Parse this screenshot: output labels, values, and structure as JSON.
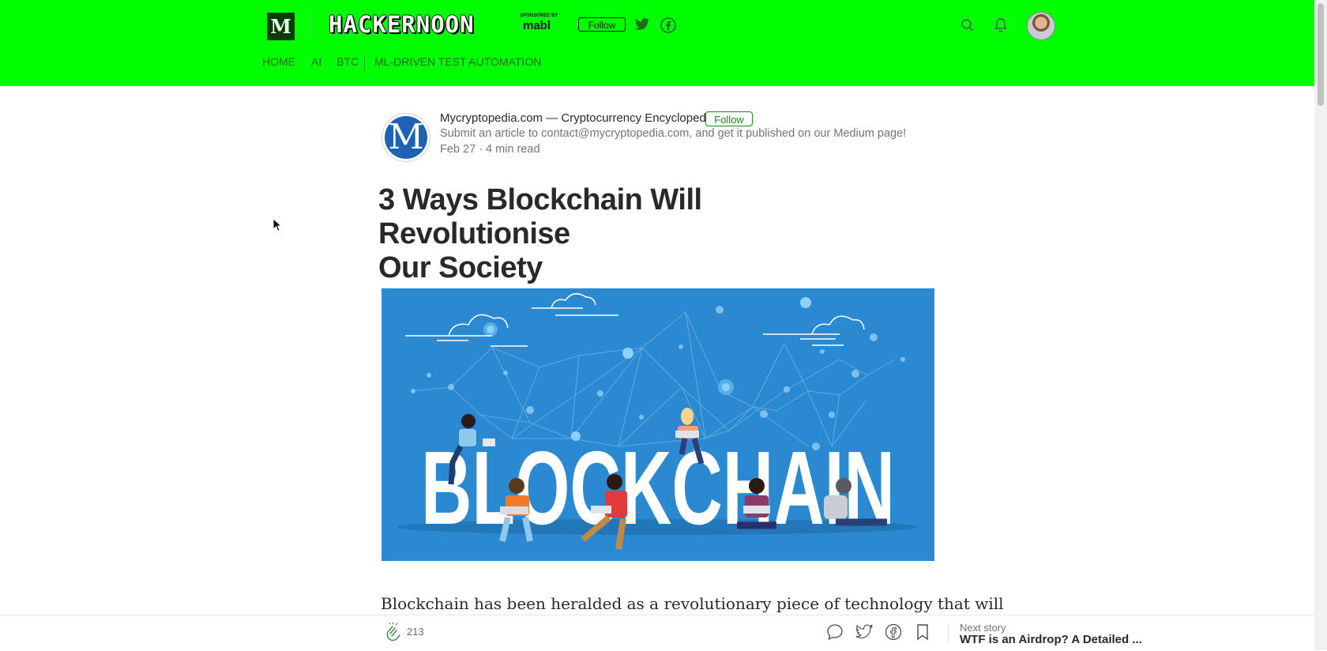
{
  "header": {
    "publication_name": "HACKERNOON",
    "sponsored_by": "SPONSORED BY",
    "sponsor": "mabl",
    "follow_label": "Follow",
    "logo_letter": "M",
    "nav": [
      "HOME",
      "AI",
      "BTC",
      "ML-DRIVEN TEST AUTOMATION"
    ],
    "icons": [
      "twitter-icon",
      "facebook-icon",
      "search-icon",
      "bell-icon",
      "avatar"
    ]
  },
  "author": {
    "avatar_letter": "M",
    "name": "Mycryptopedia.com — Cryptocurrency Encyclopedia",
    "follow_label": "Follow",
    "bio": "Submit an article to contact@mycryptopedia.com, and get it published on our Medium page!",
    "date": "Feb 27",
    "read_time": "4 min read"
  },
  "article": {
    "title_line1": "3 Ways Blockchain Will Revolutionise",
    "title_line2": "Our Society",
    "hero_word": "BLOCKCHAIN",
    "first_line": "Blockchain has been heralded as a revolutionary piece of technology that will"
  },
  "bottom_bar": {
    "clap_count": "213",
    "next_label": "Next story",
    "next_title": "WTF is an Airdrop? A Detailed ..."
  },
  "colors": {
    "header_bg": "#00ff00",
    "hero_bg": "#2a89d0",
    "follow_green": "#1a8917"
  }
}
